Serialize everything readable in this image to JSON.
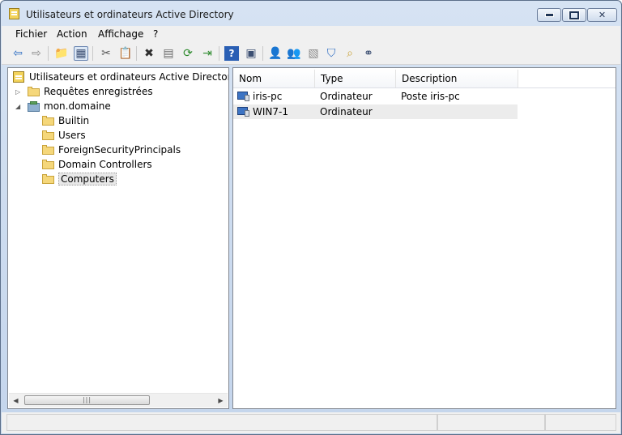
{
  "window": {
    "title": "Utilisateurs et ordinateurs Active Directory",
    "minimize_label": "minimize",
    "maximize_label": "maximize",
    "close_label": "close"
  },
  "menu": [
    {
      "label": "Fichier"
    },
    {
      "label": "Action"
    },
    {
      "label": "Affichage"
    },
    {
      "label": "?"
    }
  ],
  "toolbar": [
    {
      "icon": "back-arrow-icon",
      "glyph": "⇦",
      "color": "#2a6bc2"
    },
    {
      "icon": "forward-arrow-icon",
      "glyph": "⇨",
      "color": "#8a8a8a"
    },
    {
      "icon": "up-folder-icon",
      "glyph": "📁",
      "color": "#c9a33a"
    },
    {
      "icon": "show-console-tree-icon",
      "glyph": "▦",
      "color": "#3c4f72",
      "pressed": true
    },
    {
      "icon": "cut-icon",
      "glyph": "✂",
      "color": "#555555"
    },
    {
      "icon": "copy-icon",
      "glyph": "📋",
      "color": "#555555"
    },
    {
      "icon": "delete-icon",
      "glyph": "✖",
      "color": "#2e2e2e"
    },
    {
      "icon": "properties-icon",
      "glyph": "▤",
      "color": "#6a6a6a"
    },
    {
      "icon": "refresh-icon",
      "glyph": "⟳",
      "color": "#2d8a2d"
    },
    {
      "icon": "export-list-icon",
      "glyph": "⇥",
      "color": "#2d8a2d"
    },
    {
      "icon": "help-icon",
      "glyph": "?",
      "color": "#ffffff"
    },
    {
      "icon": "action-pane-icon",
      "glyph": "▣",
      "color": "#3c4f72"
    },
    {
      "icon": "new-user-icon",
      "glyph": "👤",
      "color": "#c9a33a"
    },
    {
      "icon": "new-group-icon",
      "glyph": "👥",
      "color": "#c9a33a"
    },
    {
      "icon": "new-ou-icon",
      "glyph": "▧",
      "color": "#8a8a8a"
    },
    {
      "icon": "filter-icon",
      "glyph": "⛉",
      "color": "#2a6bc2"
    },
    {
      "icon": "find-icon",
      "glyph": "⌕",
      "color": "#c9a33a"
    },
    {
      "icon": "add-to-group-icon",
      "glyph": "⚭",
      "color": "#3c4f72"
    }
  ],
  "tree": {
    "root_label": "Utilisateurs et ordinateurs Active Directory [kwa",
    "items": [
      {
        "label": "Requêtes enregistrées",
        "level": 1,
        "icon": "folder-icon",
        "expander": "▷"
      },
      {
        "label": "mon.domaine",
        "level": 1,
        "icon": "domain-icon",
        "expander": "◢"
      },
      {
        "label": "Builtin",
        "level": 2,
        "icon": "folder-icon"
      },
      {
        "label": "Users",
        "level": 2,
        "icon": "folder-icon"
      },
      {
        "label": "ForeignSecurityPrincipals",
        "level": 2,
        "icon": "folder-icon"
      },
      {
        "label": "Domain Controllers",
        "level": 2,
        "icon": "folder-icon"
      },
      {
        "label": "Computers",
        "level": 2,
        "icon": "folder-icon",
        "selected": true
      }
    ]
  },
  "list": {
    "columns": [
      "Nom",
      "Type",
      "Description"
    ],
    "rows": [
      {
        "name": "iris-pc",
        "type": "Ordinateur",
        "description": "Poste iris-pc"
      },
      {
        "name": "WIN7-1",
        "type": "Ordinateur",
        "description": ""
      }
    ]
  },
  "scroll": {
    "left": "◀",
    "right": "▶",
    "grip": "|||"
  },
  "colors": {
    "title_bar": "#c4d5ec",
    "menu_bg": "#f0f0f0",
    "selection_row": "#ececec"
  }
}
